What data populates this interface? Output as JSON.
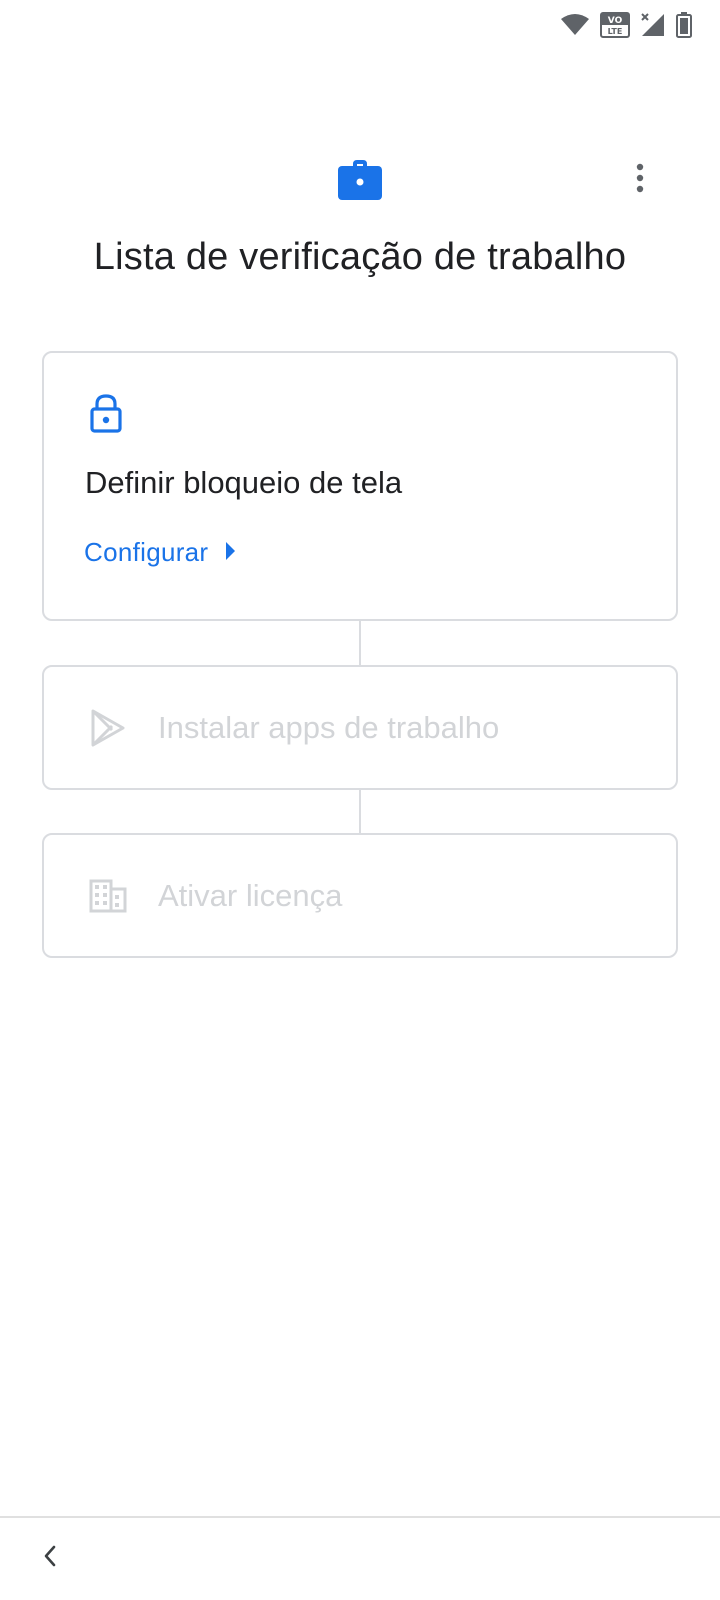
{
  "status_bar": {
    "icons": [
      "wifi-icon",
      "volte-icon",
      "signal-icon",
      "battery-icon"
    ],
    "volte_top": "VO",
    "volte_bottom": "LTE"
  },
  "header": {
    "icon": "briefcase-icon",
    "menu_icon": "more-vert-icon",
    "title": "Lista de verificação de trabalho"
  },
  "checklist": {
    "steps": [
      {
        "icon": "lock-icon",
        "title": "Definir bloqueio de tela",
        "action_label": "Configurar",
        "enabled": true
      },
      {
        "icon": "play-store-icon",
        "title": "Instalar apps de trabalho",
        "enabled": false
      },
      {
        "icon": "building-icon",
        "title": "Ativar licença",
        "enabled": false
      }
    ]
  },
  "navigation": {
    "back_icon": "chevron-left-icon"
  },
  "colors": {
    "accent": "#1a73e8",
    "text_primary": "#202124",
    "text_disabled": "#d2d4d7",
    "border": "#dadce0",
    "status_icon": "#5f6368"
  }
}
